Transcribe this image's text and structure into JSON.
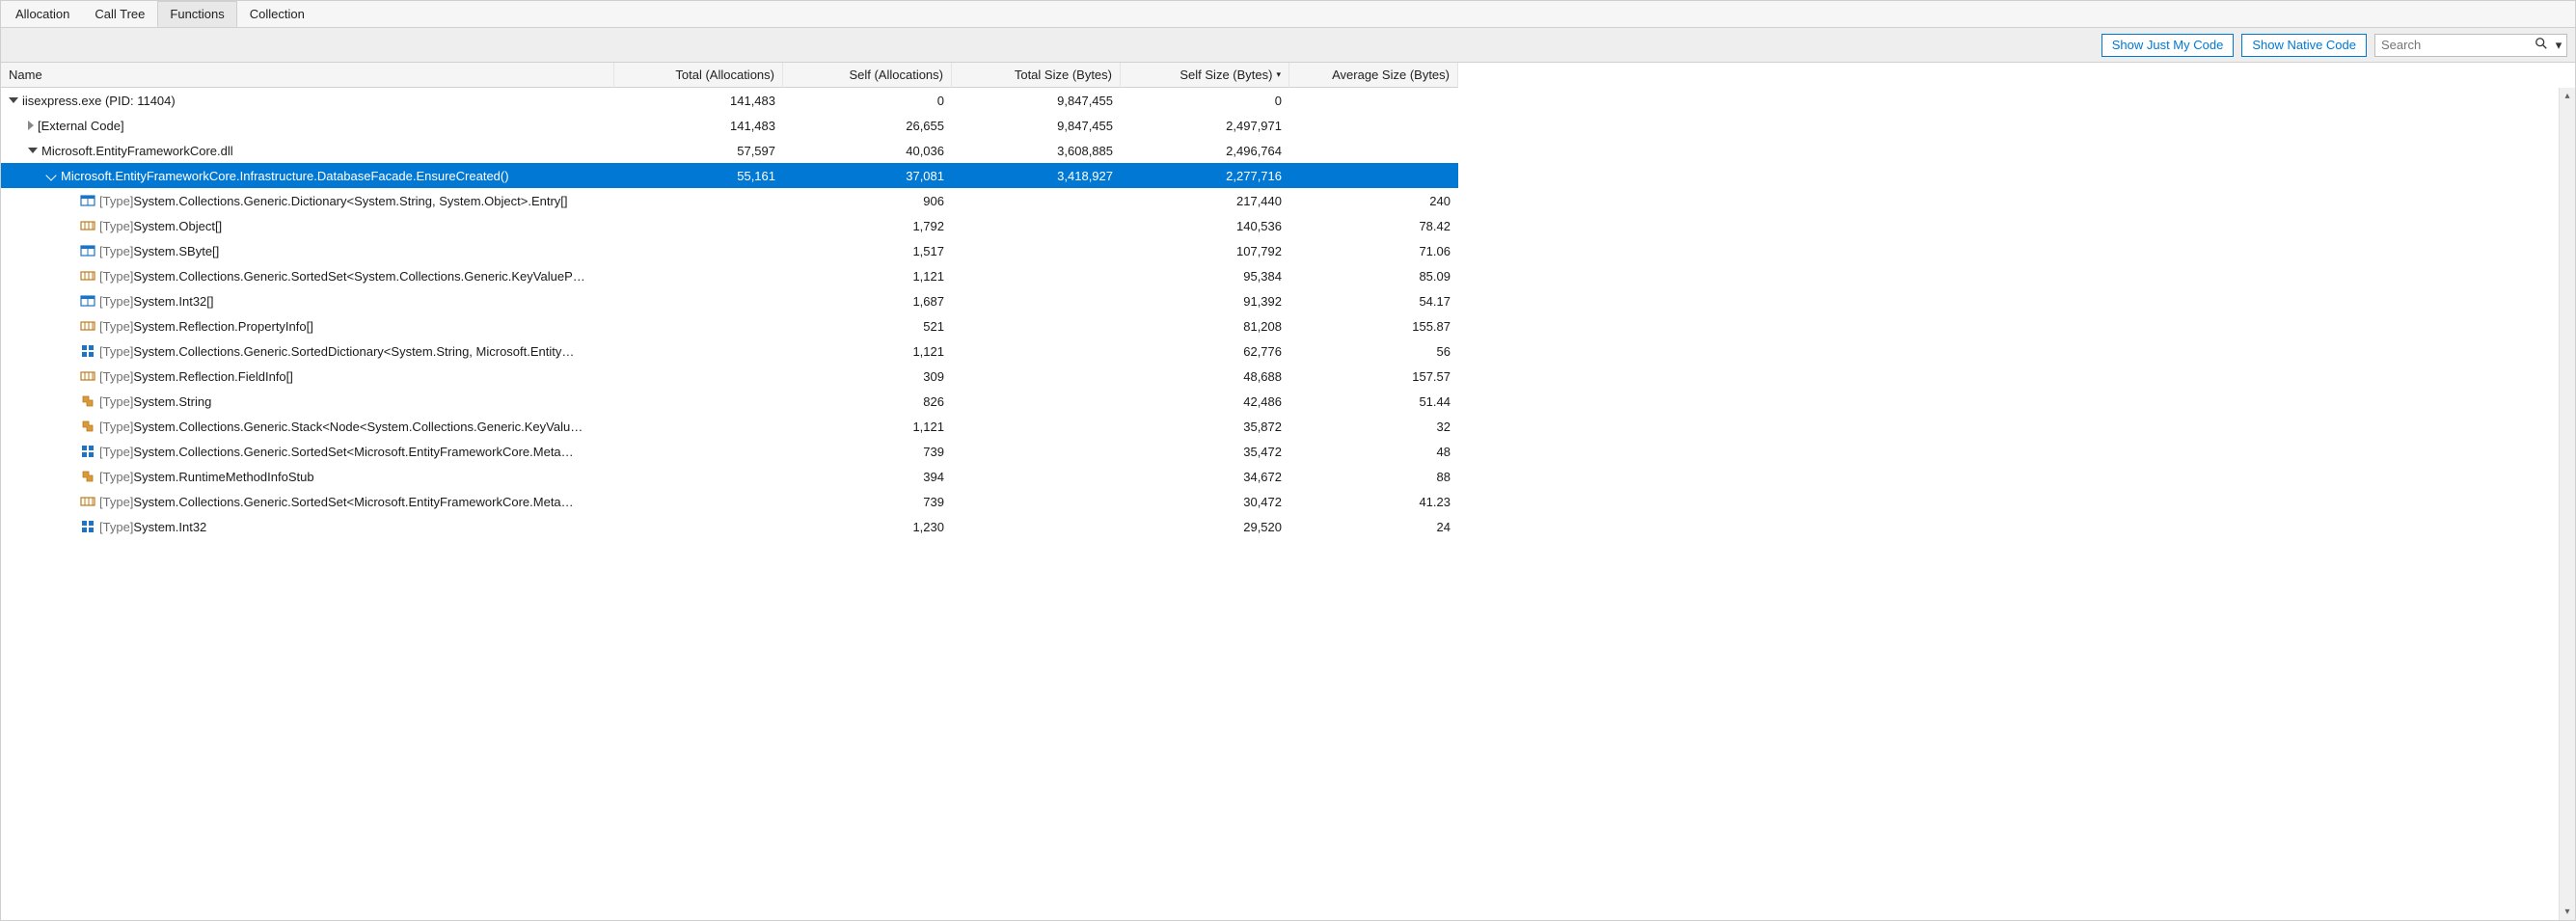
{
  "tabs": [
    {
      "label": "Allocation",
      "active": false
    },
    {
      "label": "Call Tree",
      "active": false
    },
    {
      "label": "Functions",
      "active": true
    },
    {
      "label": "Collection",
      "active": false
    }
  ],
  "toolbar": {
    "show_my_code": "Show Just My Code",
    "show_native": "Show Native Code",
    "search_placeholder": "Search"
  },
  "columns": {
    "name": "Name",
    "total_alloc": "Total (Allocations)",
    "self_alloc": "Self (Allocations)",
    "total_size": "Total Size (Bytes)",
    "self_size": "Self Size (Bytes)",
    "avg_size": "Average Size (Bytes)",
    "sort_col": "self_size",
    "sort_dir_glyph": "▾"
  },
  "rows": [
    {
      "indent": 0,
      "expander": "open",
      "icon": "",
      "prefix": "",
      "name": "iisexpress.exe (PID: 11404)",
      "total_alloc": "141,483",
      "self_alloc": "0",
      "total_size": "9,847,455",
      "self_size": "0",
      "avg_size": "",
      "selected": false
    },
    {
      "indent": 1,
      "expander": "closed",
      "icon": "",
      "prefix": "",
      "name": "[External Code]",
      "total_alloc": "141,483",
      "self_alloc": "26,655",
      "total_size": "9,847,455",
      "self_size": "2,497,971",
      "avg_size": "",
      "selected": false
    },
    {
      "indent": 1,
      "expander": "open",
      "icon": "",
      "prefix": "",
      "name": "Microsoft.EntityFrameworkCore.dll",
      "total_alloc": "57,597",
      "self_alloc": "40,036",
      "total_size": "3,608,885",
      "self_size": "2,496,764",
      "avg_size": "",
      "selected": false
    },
    {
      "indent": 2,
      "expander": "openout",
      "icon": "",
      "prefix": "",
      "name": "Microsoft.EntityFrameworkCore.Infrastructure.DatabaseFacade.EnsureCreated()",
      "total_alloc": "55,161",
      "self_alloc": "37,081",
      "total_size": "3,418,927",
      "self_size": "2,277,716",
      "avg_size": "",
      "selected": true
    },
    {
      "indent": 3,
      "expander": "",
      "icon": "struct",
      "prefix": "[Type] ",
      "name": "System.Collections.Generic.Dictionary<System.String, System.Object>.Entry[]",
      "total_alloc": "",
      "self_alloc": "906",
      "total_size": "",
      "self_size": "217,440",
      "avg_size": "240",
      "selected": false
    },
    {
      "indent": 3,
      "expander": "",
      "icon": "array",
      "prefix": "[Type] ",
      "name": "System.Object[]",
      "total_alloc": "",
      "self_alloc": "1,792",
      "total_size": "",
      "self_size": "140,536",
      "avg_size": "78.42",
      "selected": false
    },
    {
      "indent": 3,
      "expander": "",
      "icon": "struct",
      "prefix": "[Type] ",
      "name": "System.SByte[]",
      "total_alloc": "",
      "self_alloc": "1,517",
      "total_size": "",
      "self_size": "107,792",
      "avg_size": "71.06",
      "selected": false
    },
    {
      "indent": 3,
      "expander": "",
      "icon": "array",
      "prefix": "[Type] ",
      "name": "System.Collections.Generic.SortedSet<System.Collections.Generic.KeyValueP…",
      "total_alloc": "",
      "self_alloc": "1,121",
      "total_size": "",
      "self_size": "95,384",
      "avg_size": "85.09",
      "selected": false
    },
    {
      "indent": 3,
      "expander": "",
      "icon": "struct",
      "prefix": "[Type] ",
      "name": "System.Int32[]",
      "total_alloc": "",
      "self_alloc": "1,687",
      "total_size": "",
      "self_size": "91,392",
      "avg_size": "54.17",
      "selected": false
    },
    {
      "indent": 3,
      "expander": "",
      "icon": "array",
      "prefix": "[Type] ",
      "name": "System.Reflection.PropertyInfo[]",
      "total_alloc": "",
      "self_alloc": "521",
      "total_size": "",
      "self_size": "81,208",
      "avg_size": "155.87",
      "selected": false
    },
    {
      "indent": 3,
      "expander": "",
      "icon": "class2",
      "prefix": "[Type] ",
      "name": "System.Collections.Generic.SortedDictionary<System.String, Microsoft.Entity…",
      "total_alloc": "",
      "self_alloc": "1,121",
      "total_size": "",
      "self_size": "62,776",
      "avg_size": "56",
      "selected": false
    },
    {
      "indent": 3,
      "expander": "",
      "icon": "array",
      "prefix": "[Type] ",
      "name": "System.Reflection.FieldInfo[]",
      "total_alloc": "",
      "self_alloc": "309",
      "total_size": "",
      "self_size": "48,688",
      "avg_size": "157.57",
      "selected": false
    },
    {
      "indent": 3,
      "expander": "",
      "icon": "class",
      "prefix": "[Type] ",
      "name": "System.String",
      "total_alloc": "",
      "self_alloc": "826",
      "total_size": "",
      "self_size": "42,486",
      "avg_size": "51.44",
      "selected": false
    },
    {
      "indent": 3,
      "expander": "",
      "icon": "class",
      "prefix": "[Type] ",
      "name": "System.Collections.Generic.Stack<Node<System.Collections.Generic.KeyValu…",
      "total_alloc": "",
      "self_alloc": "1,121",
      "total_size": "",
      "self_size": "35,872",
      "avg_size": "32",
      "selected": false
    },
    {
      "indent": 3,
      "expander": "",
      "icon": "class2",
      "prefix": "[Type] ",
      "name": "System.Collections.Generic.SortedSet<Microsoft.EntityFrameworkCore.Meta…",
      "total_alloc": "",
      "self_alloc": "739",
      "total_size": "",
      "self_size": "35,472",
      "avg_size": "48",
      "selected": false
    },
    {
      "indent": 3,
      "expander": "",
      "icon": "class",
      "prefix": "[Type] ",
      "name": "System.RuntimeMethodInfoStub",
      "total_alloc": "",
      "self_alloc": "394",
      "total_size": "",
      "self_size": "34,672",
      "avg_size": "88",
      "selected": false
    },
    {
      "indent": 3,
      "expander": "",
      "icon": "array",
      "prefix": "[Type] ",
      "name": "System.Collections.Generic.SortedSet<Microsoft.EntityFrameworkCore.Meta…",
      "total_alloc": "",
      "self_alloc": "739",
      "total_size": "",
      "self_size": "30,472",
      "avg_size": "41.23",
      "selected": false
    },
    {
      "indent": 3,
      "expander": "",
      "icon": "class2",
      "prefix": "[Type] ",
      "name": "System.Int32",
      "total_alloc": "",
      "self_alloc": "1,230",
      "total_size": "",
      "self_size": "29,520",
      "avg_size": "24",
      "selected": false
    }
  ]
}
